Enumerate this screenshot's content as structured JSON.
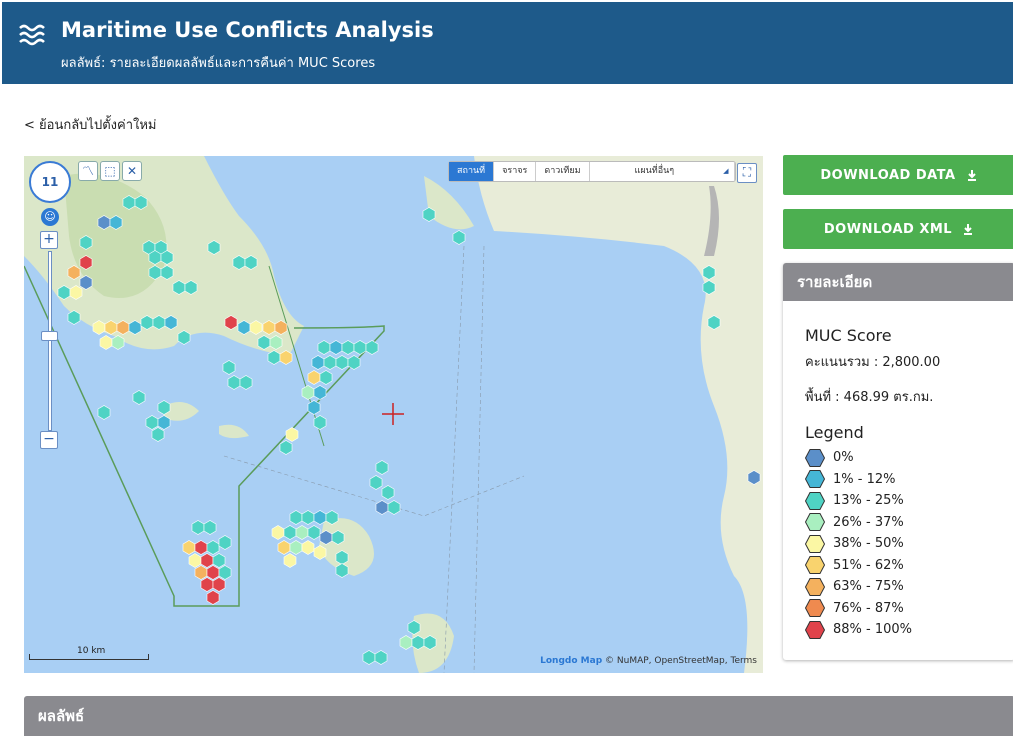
{
  "header": {
    "title": "Maritime Use Conflicts Analysis",
    "subtitle": "ผลลัพธ์: รายละเอียดผลลัพธ์และการคืนค่า MUC Scores"
  },
  "nav": {
    "back_label": "< ย้อนกลับไปตั้งค่าใหม่"
  },
  "map": {
    "zoom_level": "11",
    "zoom_in": "+",
    "zoom_out": "−",
    "layer_tabs": [
      "สถานที่",
      "จราจร",
      "ดาวเทียม"
    ],
    "layer_select": "แผนที่อื่นๆ",
    "scale_label": "10 km",
    "attribution_brand": "Longdo Map",
    "attribution_text": "© NuMAP, OpenStreetMap, Terms"
  },
  "actions": {
    "download_data": "DOWNLOAD DATA",
    "download_xml": "DOWNLOAD XML"
  },
  "details": {
    "heading": "รายละเอียด",
    "score_title": "MUC Score",
    "score_total": "คะแนนรวม : 2,800.00",
    "area": "พื้นที่ : 468.99 ตร.กม.",
    "legend_title": "Legend",
    "legend": [
      {
        "label": "0%",
        "color": "#5b8fc9"
      },
      {
        "label": "1% - 12%",
        "color": "#45b6d6"
      },
      {
        "label": "13% - 25%",
        "color": "#4fd3c4"
      },
      {
        "label": "26% - 37%",
        "color": "#a9efc0"
      },
      {
        "label": "38% - 50%",
        "color": "#fbf7a4"
      },
      {
        "label": "51% - 62%",
        "color": "#f9d36e"
      },
      {
        "label": "63% - 75%",
        "color": "#f4b15e"
      },
      {
        "label": "76% - 87%",
        "color": "#ef8a4f"
      },
      {
        "label": "88% - 100%",
        "color": "#e0434b"
      }
    ]
  },
  "results": {
    "heading": "ผลลัพธ์"
  }
}
